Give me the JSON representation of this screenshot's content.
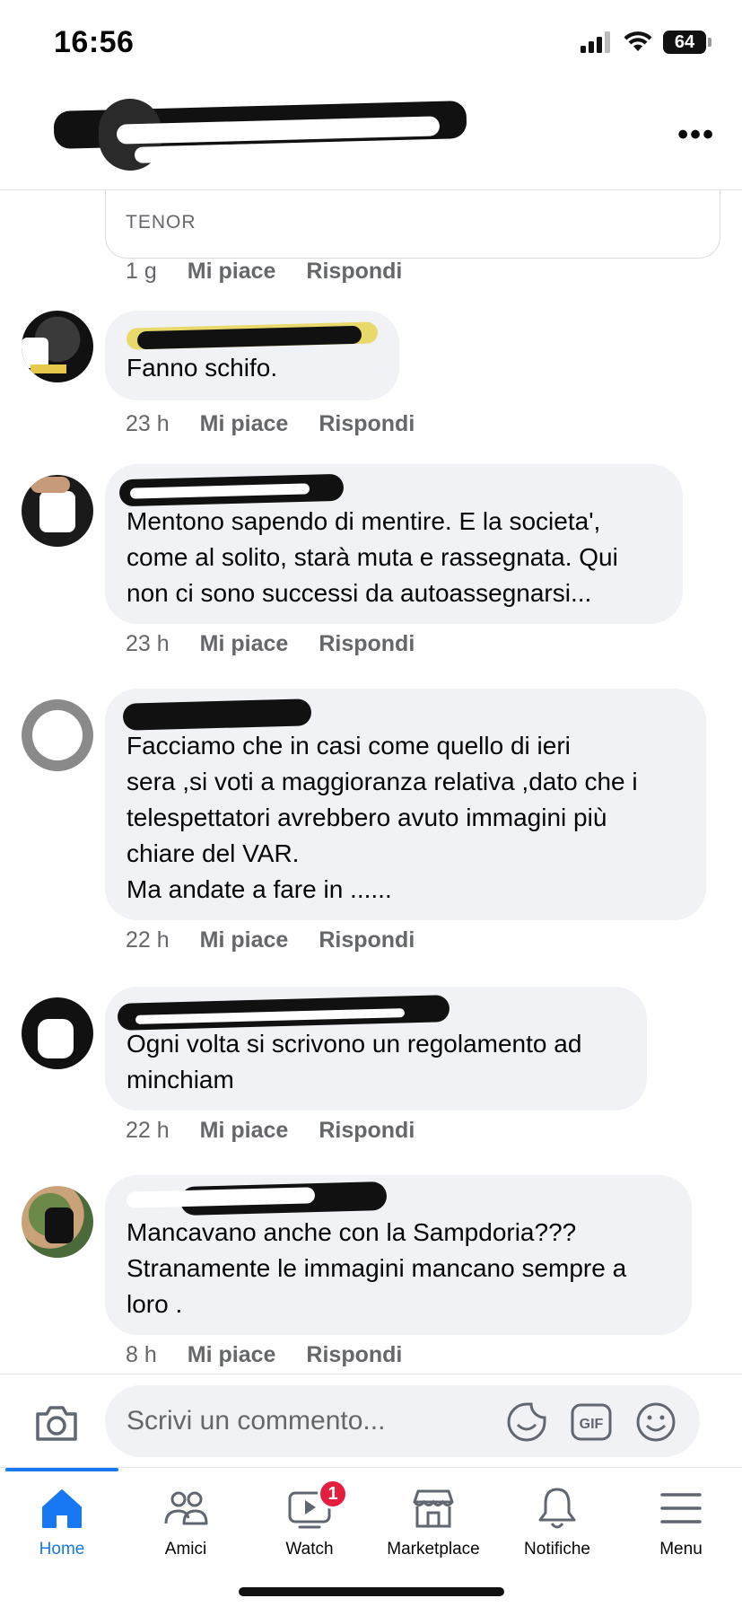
{
  "status_bar": {
    "time": "16:56",
    "battery": "64"
  },
  "colors": {
    "accent": "#1877f2",
    "badge": "#e41e3f",
    "bubble": "#f0f2f5",
    "meta_text": "#65676b"
  },
  "attachment": {
    "provider": "TENOR",
    "time": "1 g",
    "like": "Mi piace",
    "reply": "Rispondi"
  },
  "comments": [
    {
      "text": "Fanno schifo.",
      "time": "23 h",
      "like": "Mi piace",
      "reply": "Rispondi"
    },
    {
      "text": "Mentono sapendo di mentire. E la societa',\ncome al solito, starà muta e rassegnata. Qui\nnon ci sono successi da autoassegnarsi...",
      "time": "23 h",
      "like": "Mi piace",
      "reply": "Rispondi"
    },
    {
      "text": "Facciamo che in casi come quello di ieri\nsera ,si voti a maggioranza relativa ,dato che i\ntelespettatori avrebbero avuto immagini più\nchiare del VAR.\nMa andate a fare in ......",
      "time": "22 h",
      "like": "Mi piace",
      "reply": "Rispondi"
    },
    {
      "text": "Ogni volta si scrivono un regolamento ad\nminchiam",
      "time": "22 h",
      "like": "Mi piace",
      "reply": "Rispondi"
    },
    {
      "text": "Mancavano anche con la Sampdoria???\nStranamente le immagini mancano sempre a\nloro .",
      "time": "8 h",
      "like": "Mi piace",
      "reply": "Rispondi"
    }
  ],
  "composer": {
    "placeholder": "Scrivi un commento...",
    "icons": [
      "camera-icon",
      "sticker-icon",
      "gif-icon",
      "emoji-icon"
    ]
  },
  "tabbar": {
    "tabs": [
      {
        "label": "Home",
        "icon": "home-icon",
        "active": true
      },
      {
        "label": "Amici",
        "icon": "friends-icon"
      },
      {
        "label": "Watch",
        "icon": "watch-icon",
        "badge": "1"
      },
      {
        "label": "Marketplace",
        "icon": "marketplace-icon"
      },
      {
        "label": "Notifiche",
        "icon": "bell-icon"
      },
      {
        "label": "Menu",
        "icon": "menu-icon"
      }
    ]
  }
}
